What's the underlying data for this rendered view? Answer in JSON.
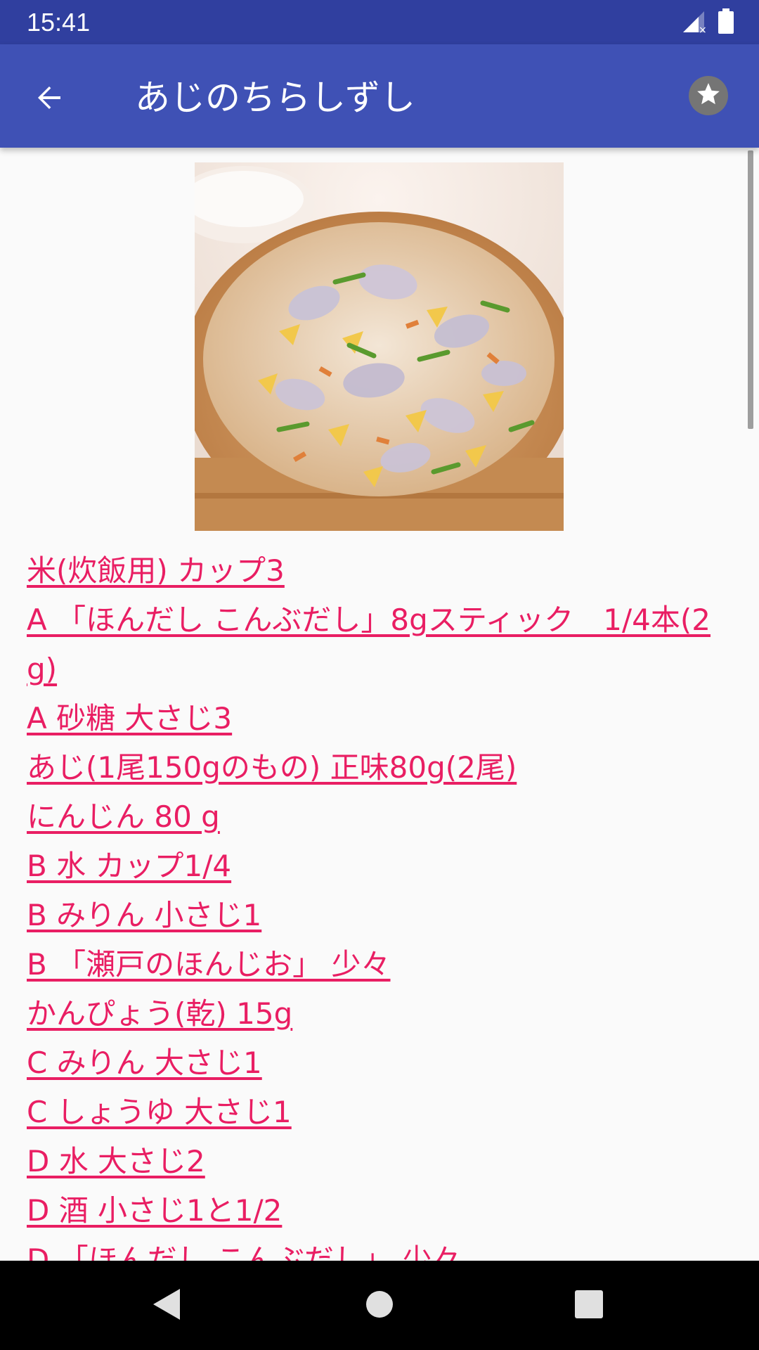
{
  "status_bar": {
    "time": "15:41",
    "icons": [
      "signal-icon",
      "battery-icon"
    ]
  },
  "app_bar": {
    "title": "あじのちらしずし",
    "back_icon": "arrow-back-icon",
    "favorite_icon": "star-icon"
  },
  "recipe": {
    "image_description": "chirashi sushi in a wooden tub",
    "ingredients": [
      "米(炊飯用) カップ3",
      "A 「ほんだし こんぶだし」8gスティック　1/4本(2g)",
      "A 砂糖 大さじ3",
      "あじ(1尾150gのもの) 正味80g(2尾)",
      "にんじん 80 g",
      "B 水 カップ1/4",
      "B みりん 小さじ1",
      "B 「瀬戸のほんじお」 少々",
      "かんぴょう(乾) 15g",
      "C みりん 大さじ1",
      "C しょうゆ 大さじ1",
      "D 水 大さじ2",
      "D 酒 小さじ1と1/2",
      "D 「ほんだし こんぶだし」 少々"
    ]
  },
  "colors": {
    "status_bar": "#303f9f",
    "app_bar": "#3f51b5",
    "link": "#e91e63",
    "background": "#fafafa"
  },
  "nav_bar": {
    "icons": [
      "back-triangle-icon",
      "home-circle-icon",
      "recents-square-icon"
    ]
  }
}
